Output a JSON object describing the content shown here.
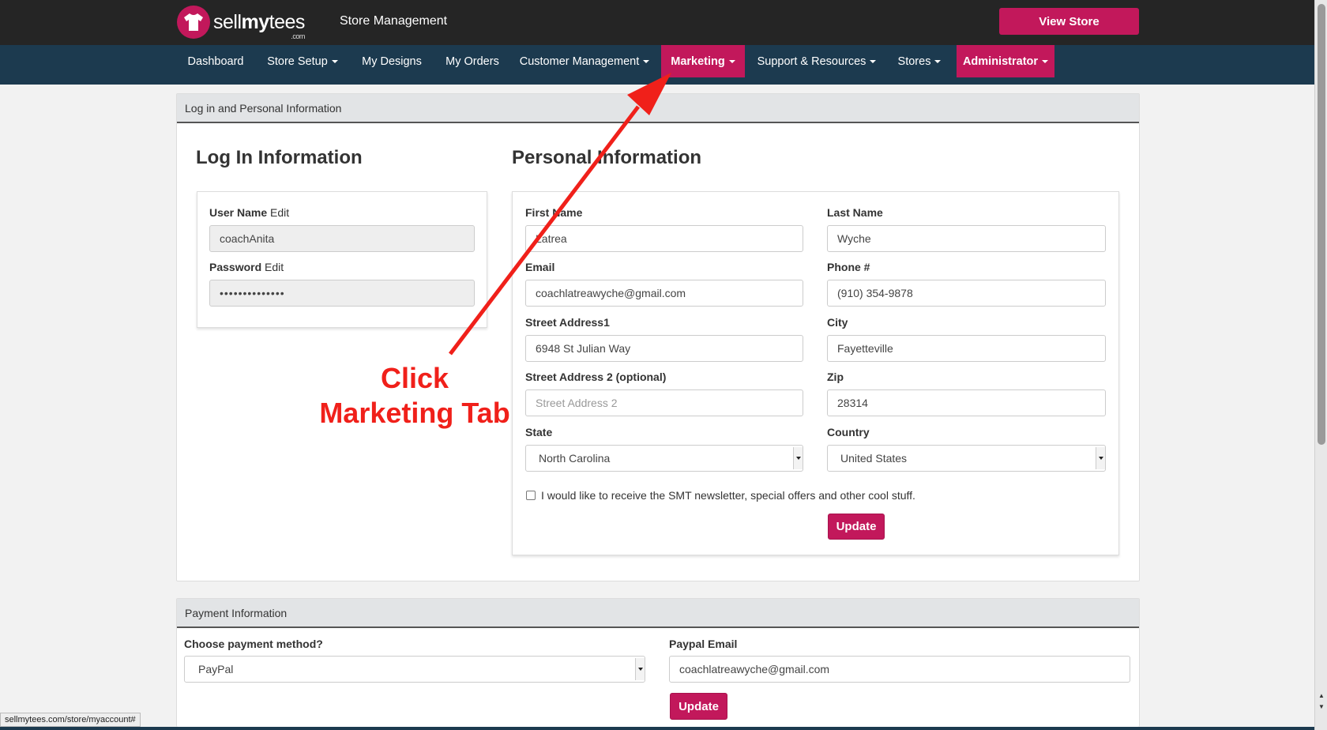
{
  "header": {
    "logo_prefix": "sell",
    "logo_bold": "my",
    "logo_suffix": "tees",
    "logo_sub": ".com",
    "title": "Store Management",
    "view_store": "View Store"
  },
  "nav": {
    "dashboard": "Dashboard",
    "store_setup": "Store Setup",
    "my_designs": "My Designs",
    "my_orders": "My Orders",
    "customer_management": "Customer Management",
    "marketing": "Marketing",
    "support": "Support & Resources",
    "stores": "Stores",
    "administrator": "Administrator"
  },
  "login_panel": {
    "heading": "Log in and Personal Information",
    "login_title": "Log In Information",
    "username_label": "User Name",
    "username_edit": "Edit",
    "username_value": "coachAnita",
    "password_label": "Password",
    "password_edit": "Edit",
    "password_value": "••••••••••••••",
    "personal_title": "Personal Information",
    "first_name_label": "First Name",
    "first_name_value": "Latrea",
    "last_name_label": "Last Name",
    "last_name_value": "Wyche",
    "email_label": "Email",
    "email_value": "coachlatreawyche@gmail.com",
    "phone_label": "Phone #",
    "phone_value": "(910) 354-9878",
    "street1_label": "Street Address1",
    "street1_value": "6948 St Julian Way",
    "city_label": "City",
    "city_value": "Fayetteville",
    "street2_label": "Street Address 2 (optional)",
    "street2_placeholder": "Street Address 2",
    "zip_label": "Zip",
    "zip_value": "28314",
    "state_label": "State",
    "state_value": "North Carolina",
    "country_label": "Country",
    "country_value": "United States",
    "newsletter_label": "I would like to receive the SMT newsletter, special offers and other cool stuff.",
    "update_button": "Update"
  },
  "payment_panel": {
    "heading": "Payment Information",
    "method_label": "Choose payment method?",
    "method_value": "PayPal",
    "paypal_email_label": "Paypal Email",
    "paypal_email_value": "coachlatreawyche@gmail.com",
    "update_button": "Update"
  },
  "annotation": {
    "line1": "Click",
    "line2": "Marketing Tab",
    "color": "#f0201a"
  },
  "status_url": "sellmytees.com/store/myaccount#",
  "colors": {
    "brand": "#c2185b",
    "topbar": "#252525",
    "navbar": "#1c3a4f"
  }
}
